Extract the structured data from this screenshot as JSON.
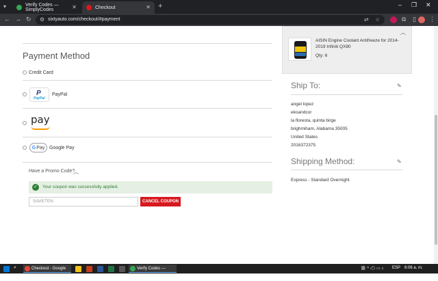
{
  "browser": {
    "tabs": [
      {
        "title": "Verify Codes — SimplyCodes",
        "active": false,
        "favicon_color": "#34a853"
      },
      {
        "title": "Checkout",
        "active": true,
        "favicon_color": "#d71920"
      }
    ],
    "new_tab": "+",
    "url": "sixtyauto.com/checkout/#payment"
  },
  "payment": {
    "title": "Payment Method",
    "options": [
      {
        "label": "Credit Card"
      },
      {
        "label": "PayPal",
        "logo_text_1": "P",
        "logo_text_2": "PayPal"
      },
      {
        "label": "",
        "logo_text": "pay"
      },
      {
        "label": "Google Pay",
        "logo_g": "G",
        "logo_text": "Pay"
      }
    ]
  },
  "promo": {
    "toggle_label": "Have a Promo Code?",
    "success_message": "Your coupon was successfully applied.",
    "code_value": "SAVETEN",
    "cancel_label": "CANCEL COUPON"
  },
  "summary": {
    "product_name": "AISIN Engine Coolant Antifreeze for 2014-2019 Infiniti QX80",
    "qty": "Qty: 6"
  },
  "ship_to": {
    "title": "Ship To:",
    "lines": [
      "angel lopez",
      "ekoandcor",
      "la floresta, quinta birge",
      "brighmiham, Alabama 35005",
      "United States",
      "2016372375"
    ]
  },
  "shipping_method": {
    "title": "Shipping Method:",
    "value": "Express - Standard Overnight"
  },
  "taskbar": {
    "apps": [
      {
        "label": "Checkout - Google C...",
        "color": "#ea4335"
      },
      {
        "label": "Verify Codes — Simpl...",
        "color": "#34a853"
      }
    ],
    "lang": "ESP",
    "time": "6:06 a. m."
  },
  "colors": {
    "accent_red": "#d71920",
    "success_green": "#2e7d32",
    "success_bg": "#e6efe3"
  }
}
